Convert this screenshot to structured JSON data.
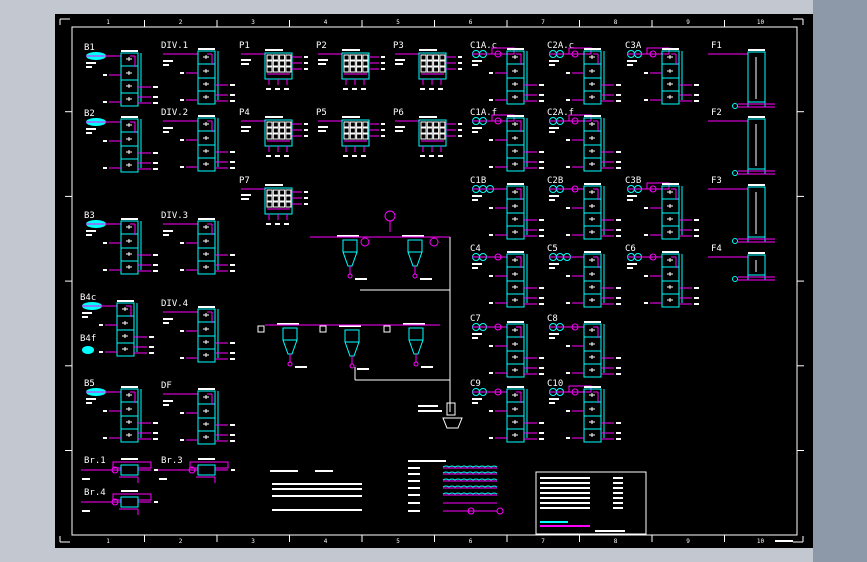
{
  "drawing": {
    "background": "#000000",
    "colors": {
      "frame": "#ffffff",
      "equipment": "#00ffff",
      "piping": "#ff00ff",
      "text": "#ffffff"
    },
    "column_numbers": [
      "1",
      "2",
      "3",
      "4",
      "5",
      "6",
      "7",
      "8",
      "9",
      "10"
    ],
    "blocks": {
      "B1": "B1",
      "B2": "B2",
      "B3": "B3",
      "B4c": "B4c",
      "B4f": "B4f",
      "B5": "B5",
      "DIV1": "DIV.1",
      "DIV2": "DIV.2",
      "DIV3": "DIV.3",
      "DIV4": "DIV.4",
      "DF": "DF",
      "P1": "P1",
      "P2": "P2",
      "P3": "P3",
      "P4": "P4",
      "P5": "P5",
      "P6": "P6",
      "P7": "P7",
      "C1Ac": "C1A.c",
      "C2Ac": "C2A.c",
      "C3A": "C3A",
      "C1Af": "C1A.f",
      "C2Af": "C2A.f",
      "C1B": "C1B",
      "C2B": "C2B",
      "C3B": "C3B",
      "C4": "C4",
      "C5": "C5",
      "C6": "C6",
      "C7": "C7",
      "C8": "C8",
      "C9": "C9",
      "C10": "C10",
      "F1": "F1",
      "F2": "F2",
      "F3": "F3",
      "F4": "F4",
      "Br1": "Br.1",
      "Br3": "Br.3",
      "Br4": "Br.4"
    }
  }
}
